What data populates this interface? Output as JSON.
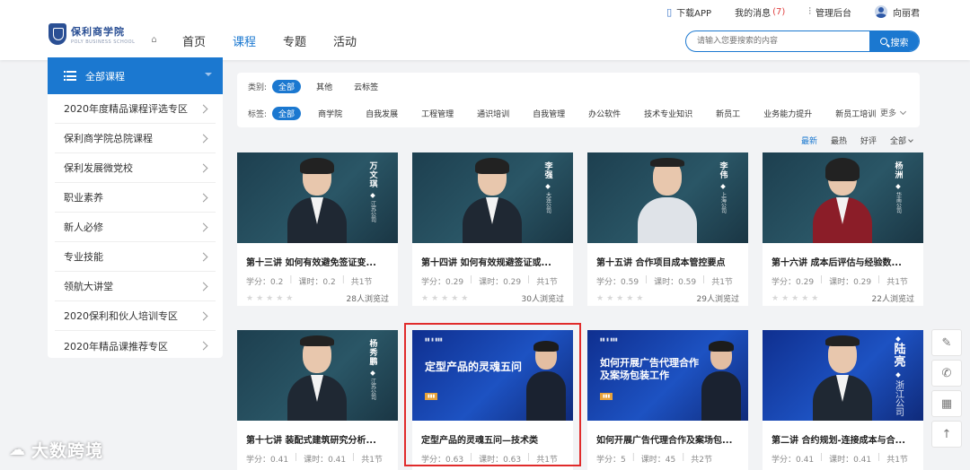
{
  "topbar": {
    "download": "下载APP",
    "messages_label": "我的消息",
    "messages_count": "(7)",
    "admin": "管理后台",
    "username": "向丽君"
  },
  "logo": {
    "name": "保利商学院",
    "sub": "POLY BUSINESS SCHOOL"
  },
  "nav": {
    "items": [
      "首页",
      "课程",
      "专题",
      "活动"
    ],
    "active": "课程"
  },
  "search": {
    "placeholder": "请输入您要搜索的内容",
    "button": "搜索"
  },
  "sidebar": {
    "title": "全部课程",
    "items": [
      "2020年度精品课程评选专区",
      "保利商学院总院课程",
      "保利发展微党校",
      "职业素养",
      "新人必修",
      "专业技能",
      "领航大讲堂",
      "2020保利和伙人培训专区",
      "2020年精品课推荐专区"
    ]
  },
  "filter": {
    "category_label": "类别:",
    "categories": [
      "全部",
      "其他",
      "云标签"
    ],
    "tag_label": "标签:",
    "tags": [
      "全部",
      "商学院",
      "自我发展",
      "工程管理",
      "通识培训",
      "自我管理",
      "办公软件",
      "技术专业知识",
      "新员工",
      "业务能力提升",
      "新员工培训"
    ],
    "more": "更多"
  },
  "sort": {
    "items": [
      "最新",
      "最热",
      "好评",
      "全部"
    ]
  },
  "cards": [
    {
      "title": "第十三讲 如何有效避免签证变...",
      "credit": "学分：0.2",
      "hours": "课时：0.2",
      "sections": "共1节",
      "views": "28人浏览过",
      "lecturer": "万文琪",
      "company": "江苏公司"
    },
    {
      "title": "第十四讲 如何有效规避签证或...",
      "credit": "学分：0.29",
      "hours": "课时：0.29",
      "sections": "共1节",
      "views": "30人浏览过",
      "lecturer": "李强",
      "company": "大连公司"
    },
    {
      "title": "第十五讲 合作项目成本管控要点",
      "credit": "学分：0.59",
      "hours": "课时：0.59",
      "sections": "共1节",
      "views": "29人浏览过",
      "lecturer": "李伟",
      "company": "上海公司"
    },
    {
      "title": "第十六讲 成本后评估与经验数...",
      "credit": "学分：0.29",
      "hours": "课时：0.29",
      "sections": "共1节",
      "views": "22人浏览过",
      "lecturer": "杨洲",
      "company": "华南公司"
    },
    {
      "title": "第十七讲 装配式建筑研究分析...",
      "credit": "学分：0.41",
      "hours": "课时：0.41",
      "sections": "共1节",
      "views": "",
      "lecturer": "杨秀鹏",
      "company": "江苏公司"
    },
    {
      "title": "定型产品的灵魂五问—技术类",
      "credit": "学分：0.63",
      "hours": "课时：0.63",
      "sections": "共1节",
      "views": "",
      "banner": "定型产品的灵魂五问"
    },
    {
      "title": "如何开展广告代理合作及案场包...",
      "credit": "学分：5",
      "hours": "课时：45",
      "sections": "共2节",
      "views": "",
      "banner": "如何开展广告代理合作及案场包装工作"
    },
    {
      "title": "第二讲 合约规划-连接成本与合...",
      "credit": "学分：0.41",
      "hours": "课时：0.41",
      "sections": "共1节",
      "views": "",
      "lecturer": "陆亮",
      "company": "浙江公司"
    }
  ],
  "watermark": "大数跨境",
  "colors": {
    "primary": "#1b78d0",
    "highlight": "#e02b2b"
  }
}
